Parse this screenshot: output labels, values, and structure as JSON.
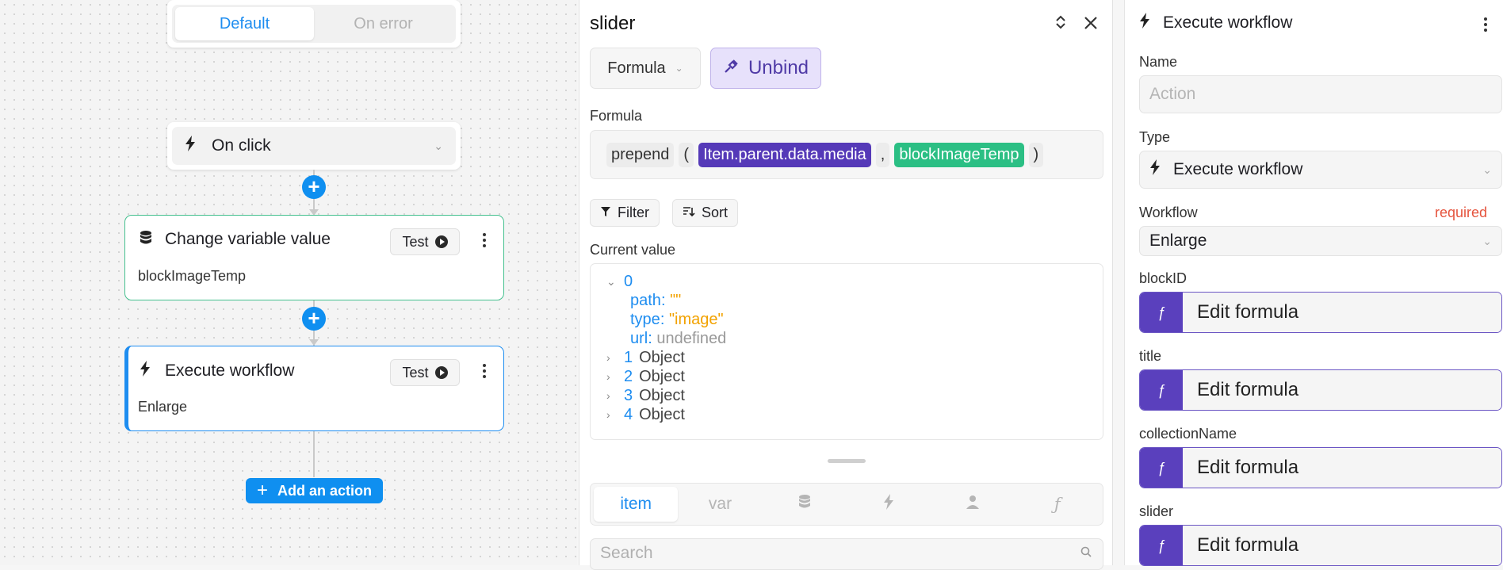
{
  "colors": {
    "accent": "#1e8df0",
    "success": "#45c08f",
    "purple": "#5539b8",
    "green_token": "#2bbf84",
    "required": "#e5533d"
  },
  "canvas": {
    "segment": {
      "default_label": "Default",
      "on_error_label": "On error"
    },
    "trigger": {
      "label": "On click",
      "icon": "bolt-icon"
    },
    "actions": [
      {
        "title": "Change variable value",
        "subtitle": "blockImageTemp",
        "test_label": "Test",
        "icon": "database-icon"
      },
      {
        "title": "Execute workflow",
        "subtitle": "Enlarge",
        "test_label": "Test",
        "icon": "bolt-icon"
      }
    ],
    "add_action_label": "Add an action"
  },
  "formula_panel": {
    "title": "slider",
    "mode_dropdown": "Formula",
    "unbind_label": "Unbind",
    "formula_label": "Formula",
    "formula_tokens": [
      "prepend",
      "(",
      "Item.parent.data.media",
      ",",
      "blockImageTemp",
      ")"
    ],
    "filter_label": "Filter",
    "sort_label": "Sort",
    "current_value_label": "Current value",
    "tree": {
      "item0": {
        "index": "0",
        "path_key": "path",
        "path_val": "\"\"",
        "type_key": "type",
        "type_val": "\"image\"",
        "url_key": "url",
        "url_val": "undefined"
      },
      "collapsed": [
        {
          "index": "1",
          "label": "Object"
        },
        {
          "index": "2",
          "label": "Object"
        },
        {
          "index": "3",
          "label": "Object"
        },
        {
          "index": "4",
          "label": "Object"
        }
      ]
    },
    "tabs": {
      "item": "item",
      "var": "var"
    },
    "search_placeholder": "Search"
  },
  "right_panel": {
    "header_title": "Execute workflow",
    "name_label": "Name",
    "name_placeholder": "Action",
    "type_label": "Type",
    "type_value": "Execute workflow",
    "workflow_label": "Workflow",
    "workflow_required": "required",
    "workflow_value": "Enlarge",
    "params": [
      {
        "label": "blockID",
        "value": "Edit formula"
      },
      {
        "label": "title",
        "value": "Edit formula"
      },
      {
        "label": "collectionName",
        "value": "Edit formula"
      },
      {
        "label": "slider",
        "value": "Edit formula"
      }
    ]
  }
}
